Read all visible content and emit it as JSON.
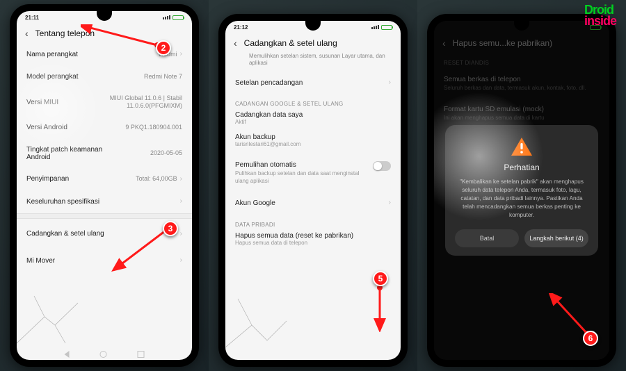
{
  "watermark": {
    "line1": "Droid",
    "line2": "inside"
  },
  "markers": {
    "m2": "2",
    "m3": "3",
    "m5": "5",
    "m6": "6"
  },
  "phone1": {
    "status": {
      "time": "21:11"
    },
    "title": "Tentang telepon",
    "rows": {
      "device_name": {
        "label": "Nama perangkat",
        "value": "Redmi"
      },
      "model": {
        "label": "Model perangkat",
        "value": "Redmi Note 7"
      },
      "miui": {
        "label": "Versi MIUI",
        "value": "MIUI Global 11.0.6 | Stabil 11.0.6.0(PFGMIXM)"
      },
      "android": {
        "label": "Versi Android",
        "value": "9 PKQ1.180904.001"
      },
      "patch": {
        "label": "Tingkat patch keamanan Android",
        "value": "2020-05-05"
      },
      "storage": {
        "label": "Penyimpanan",
        "value": "Total: 64,00GB"
      },
      "allspec": {
        "label": "Keseluruhan spesifikasi"
      },
      "backup": {
        "label": "Cadangkan & setel ulang"
      },
      "mimover": {
        "label": "Mi Mover"
      }
    }
  },
  "phone2": {
    "status": {
      "time": "21:12"
    },
    "title": "Cadangkan & setel ulang",
    "subtitle": "Memulihkan setelan sistem, susunan Layar utama, dan aplikasi",
    "rows": {
      "backup_settings": {
        "label": "Setelan pencadangan"
      },
      "section1": "CADANGAN GOOGLE & SETEL ULANG",
      "backup_my_data": {
        "label": "Cadangkan data saya",
        "sub": "Aktif"
      },
      "backup_account": {
        "label": "Akun backup",
        "sub": "tarisrilestari61@gmail.com"
      },
      "auto_restore": {
        "label": "Pemulihan otomatis",
        "sub": "Pulihkan backup setelan dan data saat menginstal ulang aplikasi"
      },
      "google_account": {
        "label": "Akun Google"
      },
      "section2": "DATA PRIBADI",
      "factory_reset": {
        "label": "Hapus semua data (reset ke pabrikan)",
        "sub": "Hapus semua data di telepon"
      }
    }
  },
  "phone3": {
    "title": "Hapus semu...ke pabrikan)",
    "section": "RESET DIANDIS",
    "row1": {
      "label": "Semua berkas di telepon",
      "sub": "Seluruh berkas dan data, termasuk akun, kontak, foto, dll."
    },
    "row2": {
      "label": "Format kartu SD emulasi (mock)",
      "sub": "Ini akan menghapus semua data di kartu"
    },
    "dialog": {
      "title": "Perhatian",
      "body": "\"Kembalikan ke setelan pabrik\" akan menghapus seluruh data telepon Anda, termasuk foto, lagu, catatan, dan data pribadi lainnya. Pastikan Anda telah mencadangkan semua berkas penting ke komputer.",
      "cancel": "Batal",
      "next": "Langkah berikut (4)"
    }
  }
}
